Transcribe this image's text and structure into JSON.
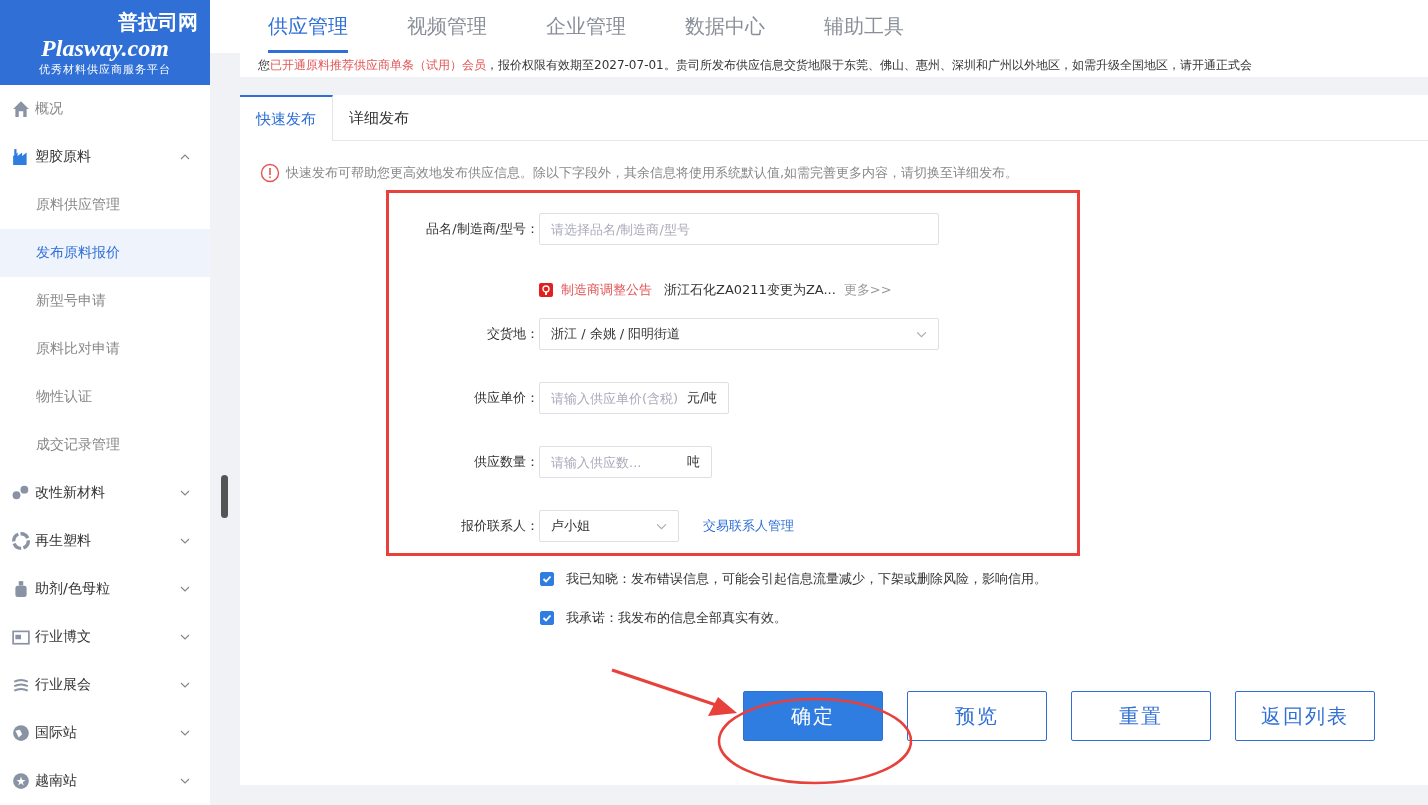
{
  "logo": {
    "name": "普拉司网",
    "domain": "Plasway.com",
    "slogan": "优秀材料供应商服务平台"
  },
  "top_nav": [
    {
      "label": "供应管理",
      "selected": true
    },
    {
      "label": "视频管理",
      "selected": false
    },
    {
      "label": "企业管理",
      "selected": false
    },
    {
      "label": "数据中心",
      "selected": false
    },
    {
      "label": "辅助工具",
      "selected": false
    }
  ],
  "notice_banner": {
    "prefix": "您",
    "highlight": "已开通原料推荐供应商单条（试用）会员",
    "rest": "，报价权限有效期至2027-07-01。贵司所发布供应信息交货地限于东莞、佛山、惠州、深圳和广州以外地区，如需升级全国地区，请开通正式会"
  },
  "sidebar": {
    "items": [
      {
        "label": "概况",
        "kind": "link"
      },
      {
        "label": "塑胶原料",
        "kind": "group",
        "expanded": true,
        "children": [
          {
            "label": "原料供应管理",
            "selected": false
          },
          {
            "label": "发布原料报价",
            "selected": true
          },
          {
            "label": "新型号申请",
            "selected": false
          },
          {
            "label": "原料比对申请",
            "selected": false
          },
          {
            "label": "物性认证",
            "selected": false
          },
          {
            "label": "成交记录管理",
            "selected": false
          }
        ]
      },
      {
        "label": "改性新材料",
        "kind": "group",
        "expanded": false
      },
      {
        "label": "再生塑料",
        "kind": "group",
        "expanded": false
      },
      {
        "label": "助剂/色母粒",
        "kind": "group",
        "expanded": false
      },
      {
        "label": "行业博文",
        "kind": "group",
        "expanded": false
      },
      {
        "label": "行业展会",
        "kind": "group",
        "expanded": false
      },
      {
        "label": "国际站",
        "kind": "group",
        "expanded": false
      },
      {
        "label": "越南站",
        "kind": "group",
        "expanded": false
      }
    ]
  },
  "form_tabs": [
    {
      "label": "快速发布",
      "selected": true
    },
    {
      "label": "详细发布",
      "selected": false
    }
  ],
  "hint": "快速发布可帮助您更高效地发布供应信息。除以下字段外，其余信息将使用系统默认值,如需完善更多内容，请切换至详细发布。",
  "form": {
    "fields": [
      {
        "kind": "search",
        "label": "品名/制造商/型号：",
        "placeholder": "请选择品名/制造商/型号",
        "announcement": {
          "tag": "制造商调整公告",
          "text": "浙江石化ZA0211变更为ZA...",
          "more": "更多>>"
        }
      },
      {
        "kind": "select",
        "label": "交货地：",
        "value": "浙江 / 余姚 / 阳明街道"
      },
      {
        "kind": "unit",
        "label": "供应单价：",
        "placeholder": "请输入供应单价(含税)",
        "unit": "元/吨"
      },
      {
        "kind": "unit",
        "label": "供应数量：",
        "placeholder": "请输入供应数...",
        "unit": "吨"
      },
      {
        "kind": "contact",
        "label": "报价联系人：",
        "value": "卢小姐",
        "link": "交易联系人管理"
      }
    ]
  },
  "agreements": [
    {
      "text": "我已知晓：发布错误信息，可能会引起信息流量减少，下架或删除风险，影响信用。",
      "checked": true
    },
    {
      "text": "我承诺：我发布的信息全部真实有效。",
      "checked": true
    }
  ],
  "buttons": [
    {
      "label": "确定",
      "kind": "primary"
    },
    {
      "label": "预览",
      "kind": "default"
    },
    {
      "label": "重置",
      "kind": "default"
    },
    {
      "label": "返回列表",
      "kind": "default"
    }
  ]
}
